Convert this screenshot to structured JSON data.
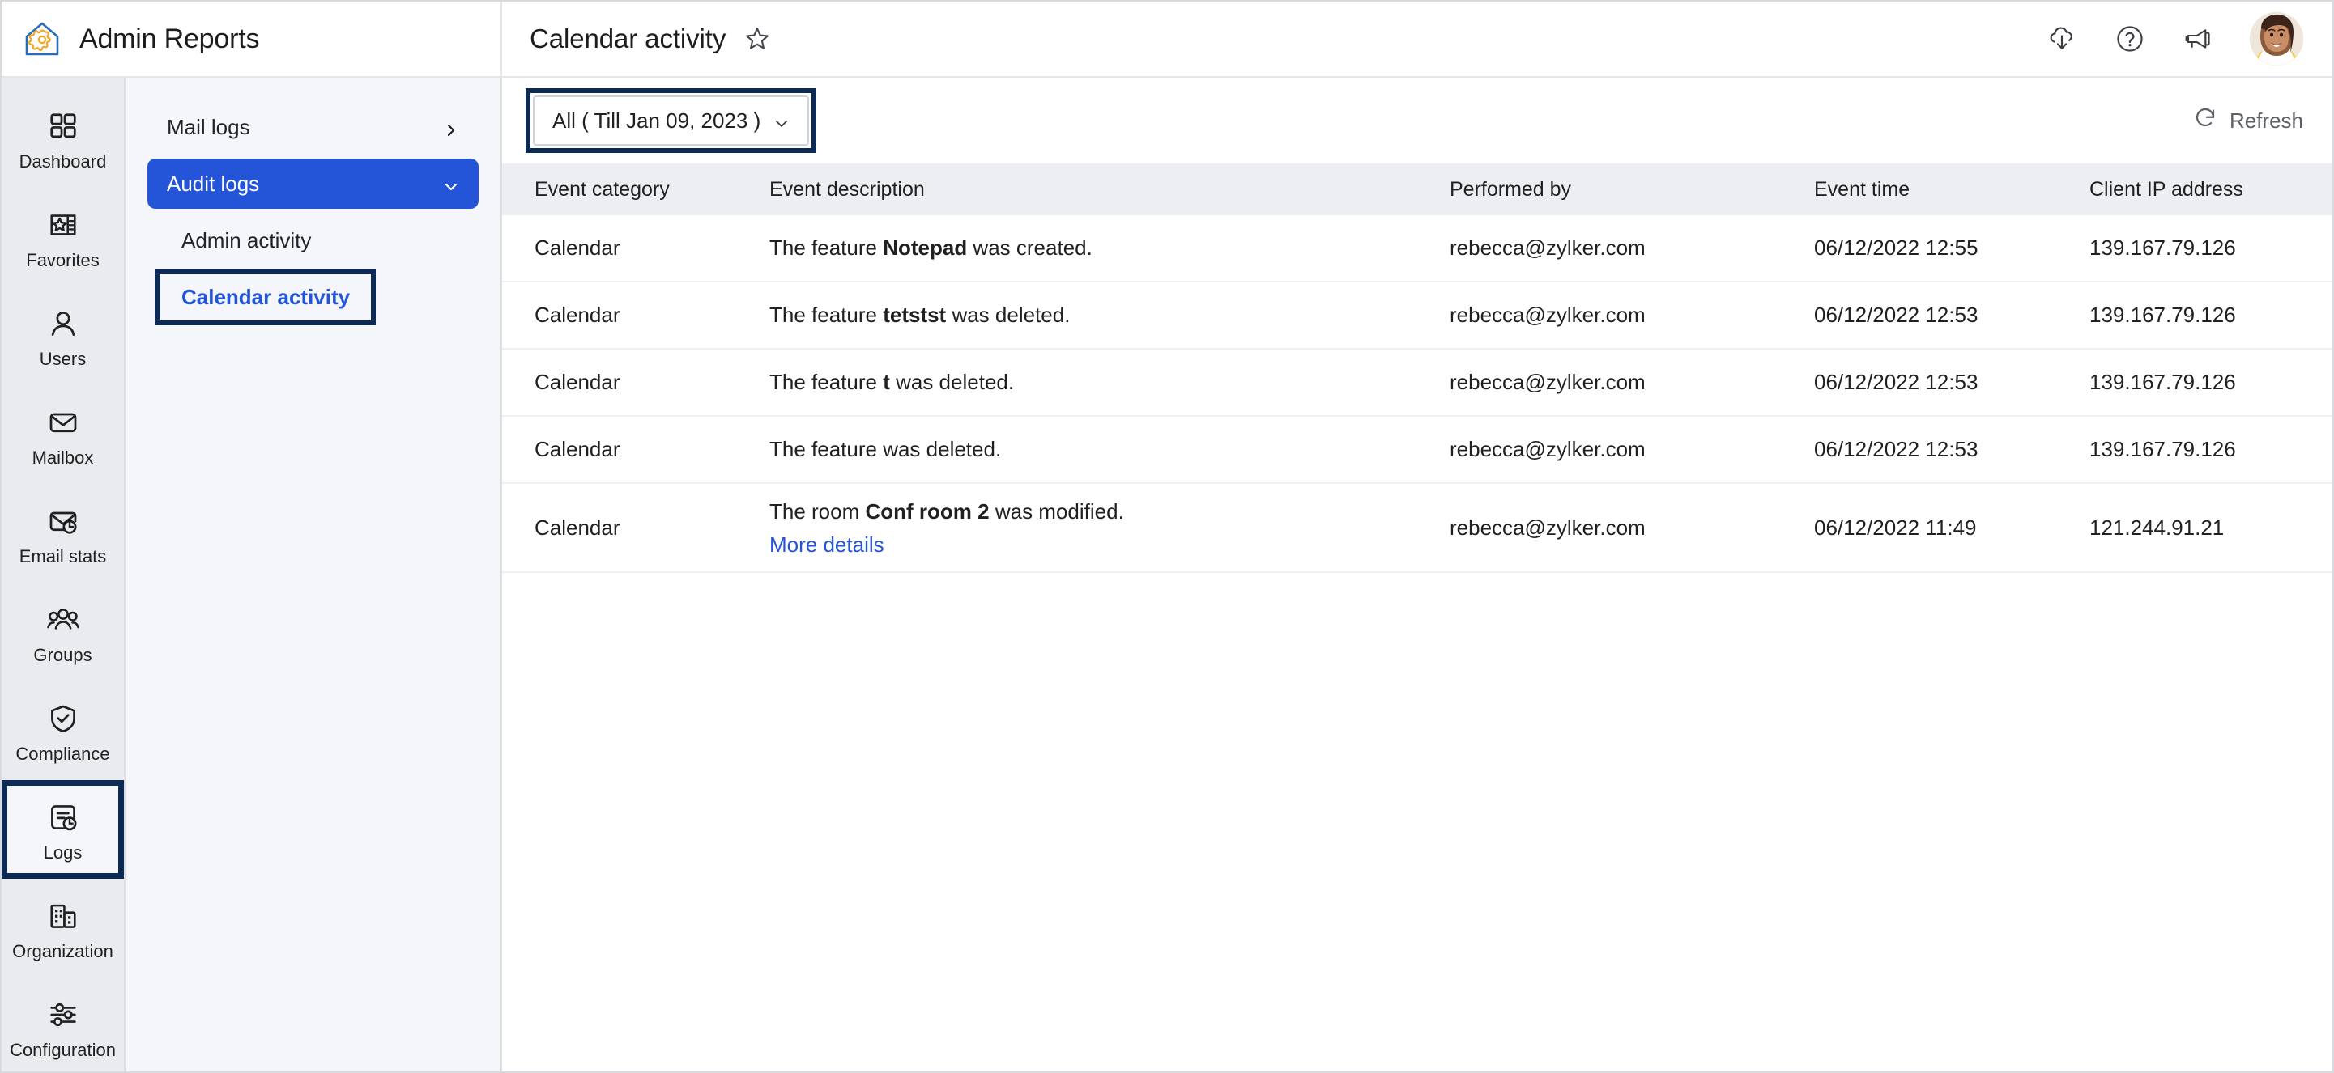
{
  "app": {
    "brand_title": "Admin Reports",
    "logo_icon": "house-gear-logo"
  },
  "header": {
    "page_title": "Calendar activity",
    "favorite_icon": "star-outline-icon",
    "actions": [
      {
        "name": "download-icon",
        "label": "Download"
      },
      {
        "name": "help-icon",
        "label": "Help"
      },
      {
        "name": "announcement-icon",
        "label": "What's new"
      }
    ],
    "avatar": {
      "name": "user-avatar",
      "alt": "User profile photo"
    }
  },
  "rail": {
    "items": [
      {
        "label": "Dashboard",
        "icon": "grid-icon",
        "selected": false
      },
      {
        "label": "Favorites",
        "icon": "star-document-icon",
        "selected": false
      },
      {
        "label": "Users",
        "icon": "user-icon",
        "selected": false
      },
      {
        "label": "Mailbox",
        "icon": "envelope-icon",
        "selected": false
      },
      {
        "label": "Email stats",
        "icon": "envelope-chart-icon",
        "selected": false
      },
      {
        "label": "Groups",
        "icon": "people-icon",
        "selected": false
      },
      {
        "label": "Compliance",
        "icon": "shield-check-icon",
        "selected": false
      },
      {
        "label": "Logs",
        "icon": "log-clock-icon",
        "selected": true
      },
      {
        "label": "Organization",
        "icon": "building-icon",
        "selected": false
      },
      {
        "label": "Configuration",
        "icon": "sliders-icon",
        "selected": false
      }
    ]
  },
  "subnav": {
    "items": [
      {
        "label": "Mail logs",
        "state": "collapsed",
        "chevron": "chevron-right-icon"
      },
      {
        "label": "Audit logs",
        "state": "expanded",
        "chevron": "chevron-down-icon"
      },
      {
        "label": "Admin activity",
        "state": "child"
      },
      {
        "label": "Calendar activity",
        "state": "child-current"
      }
    ]
  },
  "toolbar": {
    "filter_value": "All ( Till Jan 09, 2023 )",
    "filter_chevron": "chevron-down-icon",
    "refresh_label": "Refresh",
    "refresh_icon": "refresh-icon"
  },
  "table": {
    "columns": [
      "Event category",
      "Event description",
      "Performed by",
      "Event time",
      "Client IP address"
    ],
    "rows": [
      {
        "category": "Calendar",
        "desc_prefix": "The feature ",
        "desc_bold": "Notepad",
        "desc_suffix": " was created.",
        "more_details": null,
        "performed_by": "rebecca@zylker.com",
        "event_time": "06/12/2022 12:55",
        "client_ip": "139.167.79.126"
      },
      {
        "category": "Calendar",
        "desc_prefix": "The feature ",
        "desc_bold": "tetstst",
        "desc_suffix": " was deleted.",
        "more_details": null,
        "performed_by": "rebecca@zylker.com",
        "event_time": "06/12/2022 12:53",
        "client_ip": "139.167.79.126"
      },
      {
        "category": "Calendar",
        "desc_prefix": "The feature ",
        "desc_bold": "t",
        "desc_suffix": " was deleted.",
        "more_details": null,
        "performed_by": "rebecca@zylker.com",
        "event_time": "06/12/2022 12:53",
        "client_ip": "139.167.79.126"
      },
      {
        "category": "Calendar",
        "desc_prefix": "The feature was deleted.",
        "desc_bold": "",
        "desc_suffix": "",
        "more_details": null,
        "performed_by": "rebecca@zylker.com",
        "event_time": "06/12/2022 12:53",
        "client_ip": "139.167.79.126"
      },
      {
        "category": "Calendar",
        "desc_prefix": "The room ",
        "desc_bold": "Conf room 2",
        "desc_suffix": " was modified.",
        "more_details": "More details",
        "performed_by": "rebecca@zylker.com",
        "event_time": "06/12/2022 11:49",
        "client_ip": "121.244.91.21"
      }
    ]
  },
  "colors": {
    "accent_blue": "#2455d8",
    "annotation_navy": "#0d2a57",
    "rail_bg": "#e9ebee",
    "subnav_bg": "#f4f6f9",
    "table_header_bg": "#eceef1",
    "logo_blue": "#2b6cb8",
    "logo_orange": "#f5a623"
  }
}
